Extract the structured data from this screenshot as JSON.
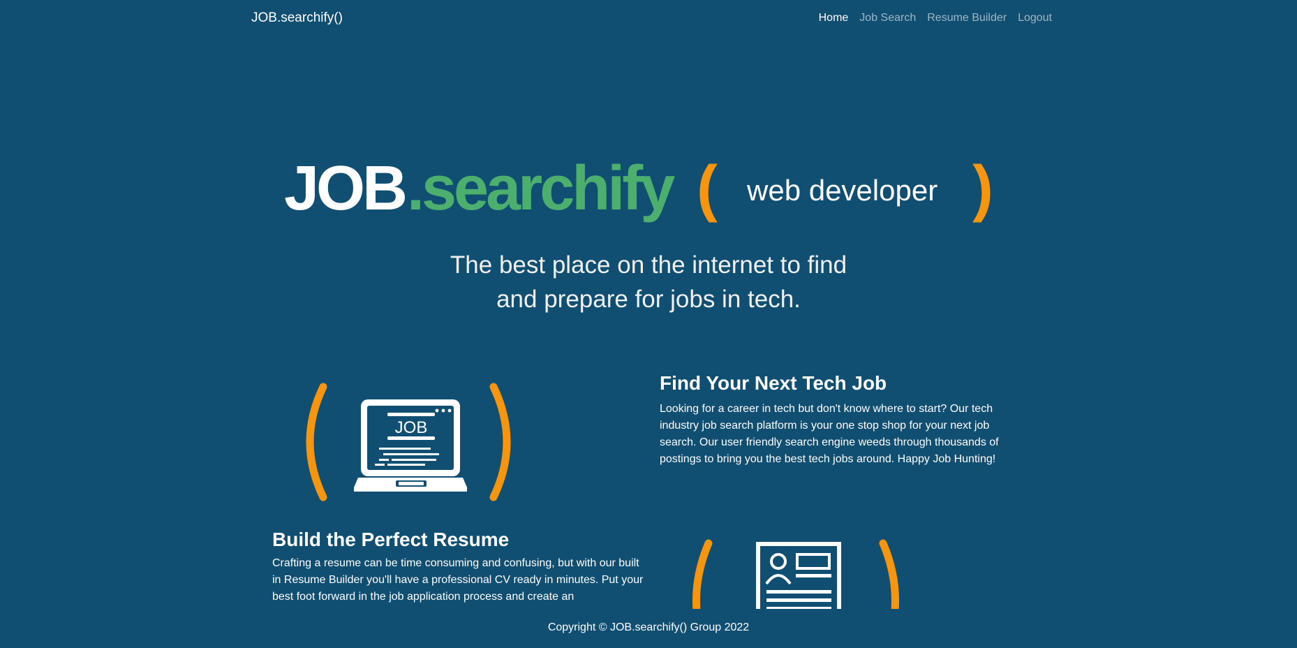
{
  "nav": {
    "brand": "JOB.searchify()",
    "links": [
      "Home",
      "Job Search",
      "Resume Builder",
      "Logout"
    ]
  },
  "hero": {
    "logo_job": "JOB",
    "logo_searchify": ".searchify",
    "left_paren": "(",
    "typed_text": "web developer",
    "right_paren": ")"
  },
  "tagline": {
    "line1": "The best place on the internet to find",
    "line2": "and prepare for jobs in tech."
  },
  "features": {
    "job": {
      "icon_text": "JOB",
      "title": "Find Your Next Tech Job",
      "text": "Looking for a career in tech but don't know where to start? Our tech industry job search platform is your one stop shop for your next job search. Our user friendly search engine weeds through thousands of postings to bring you the best tech jobs around. Happy Job Hunting!"
    },
    "resume": {
      "title": "Build the Perfect Resume",
      "text": "Crafting a resume can be time consuming and confusing, but with our built in Resume Builder you'll have a professional CV ready in minutes. Put your best foot forward in the job application process and create an"
    }
  },
  "footer": {
    "copyright": "Copyright © JOB.searchify() Group 2022"
  },
  "colors": {
    "background": "#114f72",
    "accent_orange": "#f7950e",
    "accent_green": "#4caf6e"
  }
}
